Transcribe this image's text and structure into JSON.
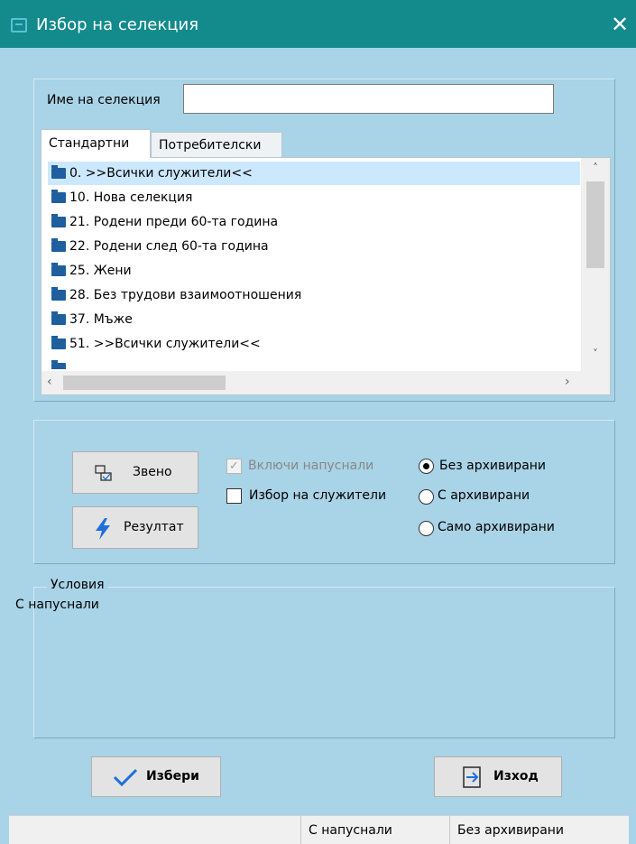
{
  "window": {
    "title": "Избор на селекция",
    "close_glyph": "✕",
    "app_icon": "selection-app-icon"
  },
  "name_field": {
    "label": "Име на селекция",
    "value": ""
  },
  "tabs": [
    {
      "label": "Стандартни",
      "active": true
    },
    {
      "label": "Потребителски",
      "active": false
    }
  ],
  "selections": [
    {
      "label": "0. >>Всички служители<<",
      "selected": true
    },
    {
      "label": "10. Нова селекция",
      "selected": false
    },
    {
      "label": "21. Родени преди 60-та година",
      "selected": false
    },
    {
      "label": "22. Родени след 60-та година",
      "selected": false
    },
    {
      "label": "25. Жени",
      "selected": false
    },
    {
      "label": "28. Без трудови взаимоотношения",
      "selected": false
    },
    {
      "label": "37. Мъже",
      "selected": false
    },
    {
      "label": "51. >>Всички служители<<",
      "selected": false
    }
  ],
  "actions": {
    "zveno_label": "Звено",
    "result_label": "Резултат"
  },
  "options": {
    "include_resigned": {
      "label": "Включи напуснали",
      "checked": true,
      "disabled": true
    },
    "select_employees": {
      "label": "Избор на служители",
      "checked": false
    }
  },
  "archive_radios": [
    {
      "label": "Без архивирани",
      "checked": true
    },
    {
      "label": "С архивирани",
      "checked": false
    },
    {
      "label": "Само архивирани",
      "checked": false
    }
  ],
  "conditions": {
    "title": "Условия",
    "text": "С напуснали"
  },
  "footer": {
    "select_label": "Избери",
    "exit_label": "Изход"
  },
  "status": {
    "cell1": "",
    "cell2": "С напуснали",
    "cell3": "Без архивирани"
  },
  "colors": {
    "titlebar": "#138a8c",
    "client": "#a9d3e6",
    "selection": "#cce8ff",
    "folder": "#1f5f9e",
    "accent_icon": "#1e6fd9"
  }
}
